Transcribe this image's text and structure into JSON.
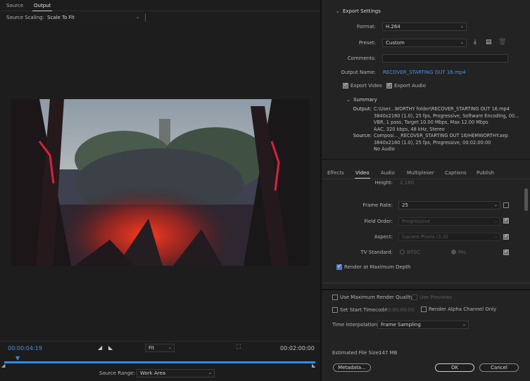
{
  "source_tabs": {
    "source": "Source",
    "output": "Output"
  },
  "source_scaling": {
    "label": "Source Scaling:",
    "value": "Scale To Fit"
  },
  "timeline": {
    "start": "00:00:04:19",
    "end": "00:02:00:00",
    "zoom": "Fit",
    "range_label": "Source Range:",
    "range_value": "Work Area"
  },
  "export_settings": {
    "title": "Export Settings",
    "format_label": "Format:",
    "format_value": "H.264",
    "preset_label": "Preset:",
    "preset_value": "Custom",
    "comments_label": "Comments:",
    "comments_value": "",
    "output_name_label": "Output Name:",
    "output_name_value": "RECOVER_STARTING OUT 16.mp4",
    "export_video": "Export Video",
    "export_audio": "Export Audio"
  },
  "summary": {
    "title": "Summary",
    "output_label": "Output:",
    "output_lines": [
      "C:\\User...WORTHY folder\\RECOVER_STARTING OUT 16.mp4",
      "3840x2160 (1.0), 25 fps, Progressive, Software Encoding, 00...",
      "VBR, 1 pass, Target 10.00 Mbps, Max 12.00 Mbps",
      "AAC, 320 kbps, 48 kHz, Stereo"
    ],
    "source_label": "Source:",
    "source_lines": [
      "Composi..._RECOVER_STARTING OUT 16/HEMWORTHY.aep",
      "3840x2160 (1.0), 25 fps, Progressive, 00:02:00:00",
      "No Audio"
    ]
  },
  "subtabs": [
    "Effects",
    "Video",
    "Audio",
    "Multiplexer",
    "Captions",
    "Publish"
  ],
  "video": {
    "height_label": "Height:",
    "height_value": "2,160",
    "frame_rate_label": "Frame Rate:",
    "frame_rate_value": "25",
    "field_order_label": "Field Order:",
    "field_order_value": "Progressive",
    "aspect_label": "Aspect:",
    "aspect_value": "Square Pixels (1.0)",
    "tv_standard_label": "TV Standard:",
    "ntsc": "NTSC",
    "pal": "PAL",
    "render_max_depth": "Render at Maximum Depth"
  },
  "bottom": {
    "max_render_quality": "Use Maximum Render Quality",
    "use_previews": "Use Previews",
    "set_start_timecode": "Set Start Timecode",
    "start_timecode_value": "00:00:00:00",
    "render_alpha": "Render Alpha Channel Only",
    "time_interp_label": "Time Interpolation:",
    "time_interp_value": "Frame Sampling",
    "file_size_label": "Estimated File Size:",
    "file_size_value": "147 MB",
    "metadata_btn": "Metadata...",
    "ok_btn": "OK",
    "cancel_btn": "Cancel"
  },
  "colors": {
    "accent": "#2d8ceb",
    "link": "#4f8fe6",
    "panel": "#232323"
  }
}
